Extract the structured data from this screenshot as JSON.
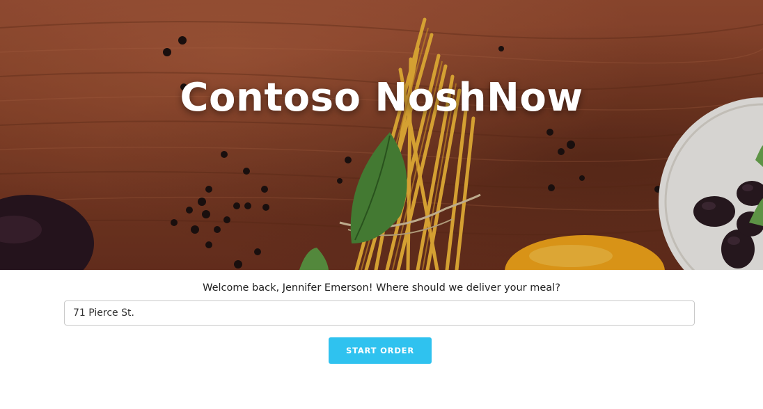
{
  "hero": {
    "title": "Contoso NoshNow"
  },
  "delivery": {
    "welcome_text": "Welcome back, Jennifer Emerson! Where should we deliver your meal?",
    "address_value": "71 Pierce St.",
    "start_button_label": "START ORDER"
  },
  "colors": {
    "accent": "#2fc2ef",
    "wood": "#8a4329"
  }
}
